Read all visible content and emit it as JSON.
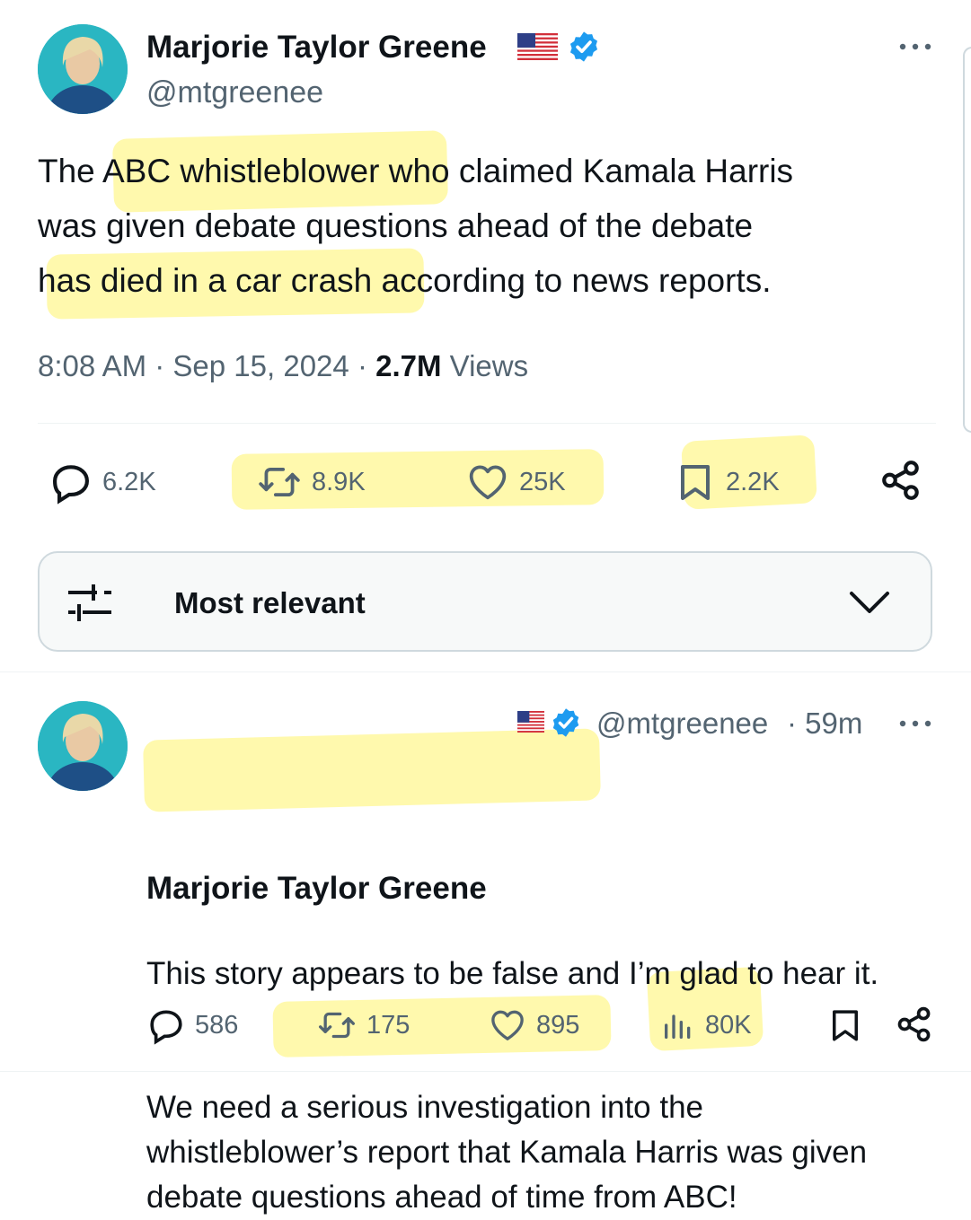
{
  "main_tweet": {
    "author_name": "Marjorie Taylor Greene",
    "handle": "@mtgreenee",
    "body": {
      "line1_pre": "The ",
      "line1_hl": "ABC whistleblower",
      "line1_post": " who claimed Kamala Harris",
      "line2": "was given debate questions ahead of the debate",
      "line3_pre": "h",
      "line3_hl": "as died in a car crash",
      "line3_post": " according to news reports."
    },
    "time": "8:08 AM",
    "sep": "·",
    "date": "Sep 15, 2024",
    "views_count": "2.7M",
    "views_label": "Views",
    "replies": "6.2K",
    "reposts": "8.9K",
    "likes": "25K",
    "bookmarks": "2.2K"
  },
  "sort": {
    "label": "Most relevant"
  },
  "reply_tweet": {
    "author_name": "Marjorie Taylor Greene",
    "handle": "@mtgreenee",
    "time": "· 59m",
    "line1_hl": "This story appears to be false",
    "line1_post": " and I’m glad to hear it.",
    "para2_line1": "We need a serious investigation into the",
    "para2_line2": "whistleblower’s report that Kamala Harris was given",
    "para2_line3": "debate questions ahead of time from ABC!",
    "replies": "586",
    "reposts": "175",
    "likes": "895",
    "views": "80K"
  },
  "icons": {
    "more": "more-dots-icon",
    "verified": "verified-badge-icon",
    "flag": "us-flag-icon",
    "reply": "reply-icon",
    "repost": "repost-icon",
    "like": "heart-icon",
    "bookmark": "bookmark-icon",
    "share": "share-icon",
    "views": "views-chart-icon",
    "filter": "filter-icon",
    "chevron": "chevron-down-icon"
  },
  "colors": {
    "verified_blue": "#1d9bf0",
    "text_primary": "#0f1419",
    "text_secondary": "#536471",
    "highlight": "#fff06a"
  }
}
